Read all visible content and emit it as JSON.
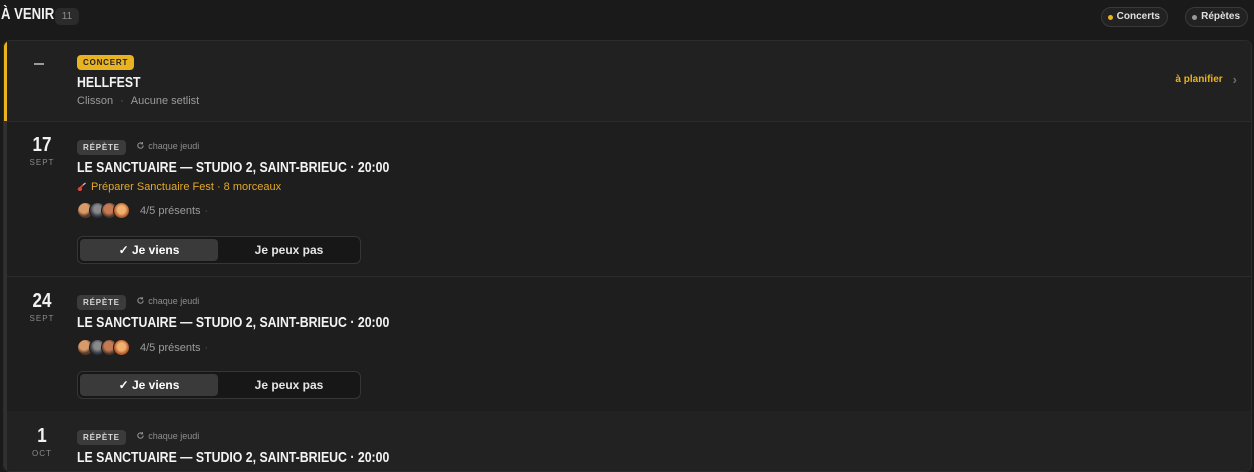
{
  "header": {
    "title": "À VENIR",
    "count": "11",
    "filters": [
      {
        "label": "Concerts",
        "color": "#e8b221"
      },
      {
        "label": "Répètes",
        "color": "#9a9a9a"
      }
    ]
  },
  "concert": {
    "badge": "CONCERT",
    "title": "HELLFEST",
    "city": "Clisson",
    "setlist": "Aucune setlist",
    "action": "à planifier"
  },
  "rehearsals": [
    {
      "day": "17",
      "month": "SEPT",
      "badge": "RÉPÈTE",
      "recurrence": "chaque jeudi",
      "title": "LE SANCTUAIRE — STUDIO 2, SAINT-BRIEUC · 20:00",
      "prep": "Préparer Sanctuaire Fest · 8 morceaux",
      "presence": "4/5 présents",
      "yes": "✓ Je viens",
      "no": "Je peux pas"
    },
    {
      "day": "24",
      "month": "SEPT",
      "badge": "RÉPÈTE",
      "recurrence": "chaque jeudi",
      "title": "LE SANCTUAIRE — STUDIO 2, SAINT-BRIEUC · 20:00",
      "presence": "4/5 présents",
      "yes": "✓ Je viens",
      "no": "Je peux pas"
    },
    {
      "day": "1",
      "month": "OCT",
      "badge": "RÉPÈTE",
      "recurrence": "chaque jeudi",
      "title": "LE SANCTUAIRE — STUDIO 2, SAINT-BRIEUC · 20:00"
    }
  ],
  "colors": {
    "accent": "#e8b221",
    "background": "#1a1a1a"
  }
}
